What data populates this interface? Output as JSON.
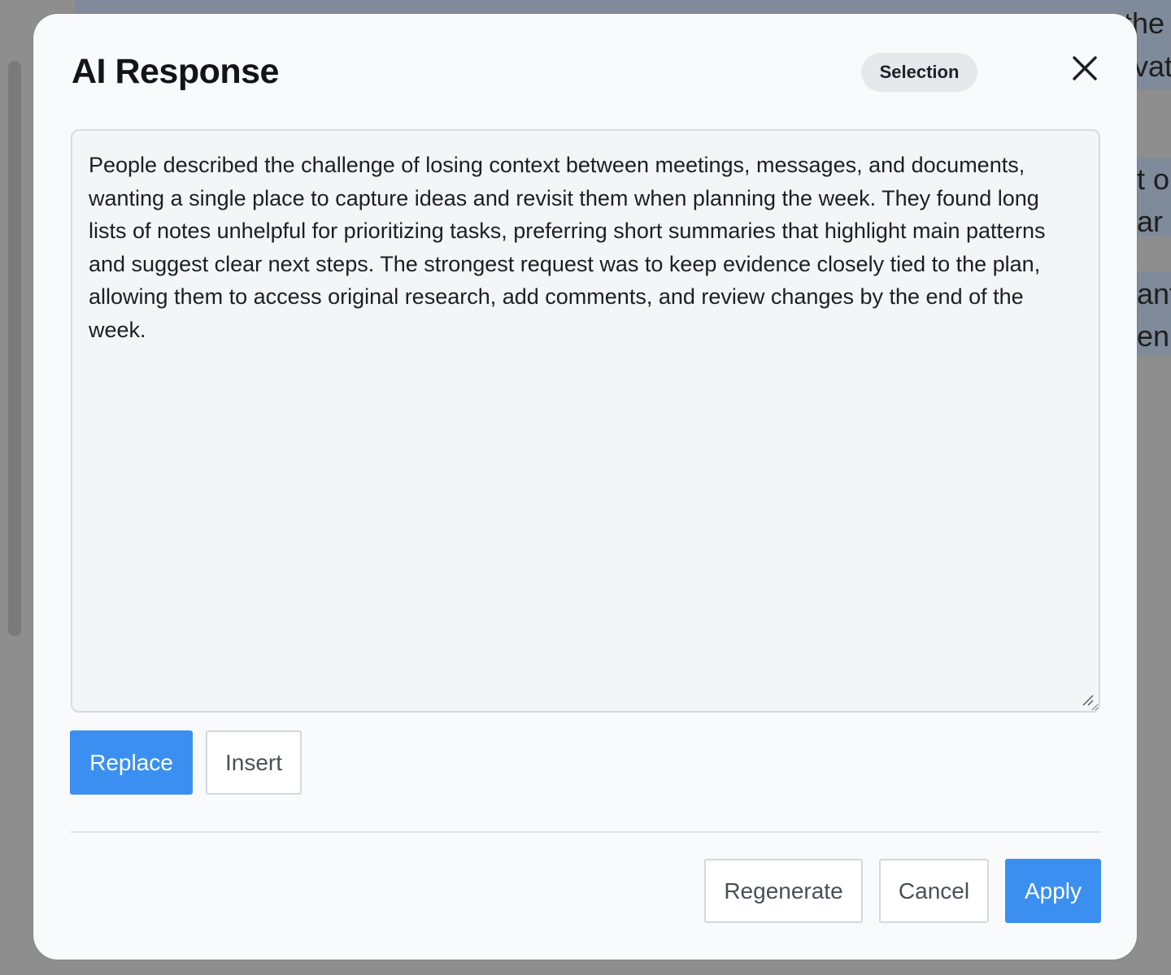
{
  "background": {
    "fragments": [
      "the",
      "vat",
      "t o",
      "ar",
      "ant",
      "en"
    ]
  },
  "dialog": {
    "title": "AI Response",
    "badge": "Selection",
    "close_icon": "close-icon",
    "response_text": "People described the challenge of losing context between meetings, messages, and documents, wanting a single place to capture ideas and revisit them when planning the week. They found long lists of notes unhelpful for prioritizing tasks, preferring short summaries that highlight main patterns and suggest clear next steps. The strongest request was to keep evidence closely tied to the plan, allowing them to access original research, add comments, and review changes by the end of the week.",
    "mode_buttons": {
      "replace": "Replace",
      "insert": "Insert"
    },
    "footer": {
      "regenerate": "Regenerate",
      "cancel": "Cancel",
      "apply": "Apply"
    }
  },
  "colors": {
    "primary": "#3b8ff0",
    "overlay": "#8e8e8e",
    "dialog_bg": "#f8fafc",
    "textarea_bg": "#f3f5f7"
  }
}
